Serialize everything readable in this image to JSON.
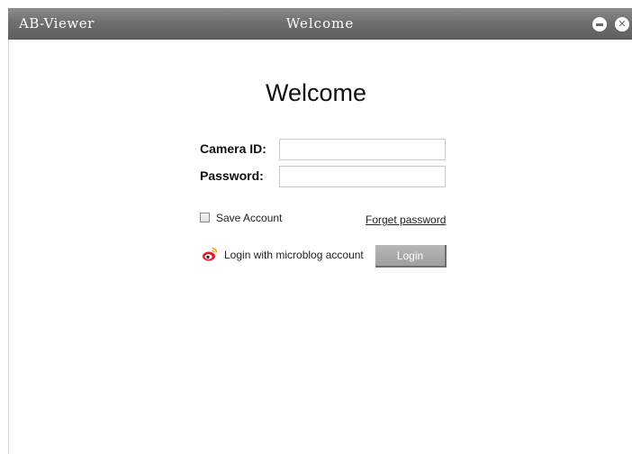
{
  "titlebar": {
    "app_name": "AB-Viewer",
    "title": "Welcome",
    "color": "#6f6f6f"
  },
  "window_controls": {
    "minimize_icon": "minimize-icon",
    "close_icon": "close-icon"
  },
  "main": {
    "heading": "Welcome",
    "camera_id_label": "Camera ID:",
    "camera_id_value": "",
    "password_label": "Password:",
    "password_value": "",
    "save_account_label": "Save Account",
    "save_account_checked": false,
    "forget_password_label": "Forget password",
    "microblog_icon": "weibo-icon",
    "microblog_login_label": "Login with microblog account",
    "login_button_label": "Login"
  }
}
